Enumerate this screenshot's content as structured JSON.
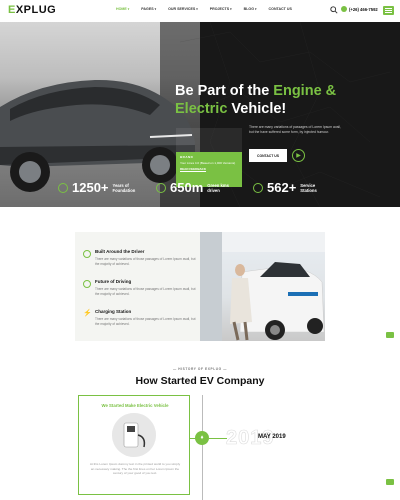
{
  "brand": {
    "logo_e": "E",
    "logo_rest": "XPLUG",
    "accent": "#7ac143"
  },
  "nav": {
    "items": [
      {
        "label": "HOME",
        "active": true
      },
      {
        "label": "PAGES"
      },
      {
        "label": "OUR SERVICES"
      },
      {
        "label": "PROJECTS"
      },
      {
        "label": "BLOG"
      },
      {
        "label": "CONTACT US"
      }
    ],
    "phone": "(+26) 466-7592"
  },
  "hero": {
    "title_1": "Be Part of the ",
    "title_engine": "Engine &",
    "title_electric": "Electric",
    "title_2": " Vehicle!",
    "promo_top": "BRAND",
    "promo_text": "Your Lines 4.0 (Based on 1,000 Versions)",
    "promo_link": "READ FEEDBACK",
    "desc": "There are many variations of passages of Lorem Ipsum avail, but the have suffered some form, by injected humour.",
    "cta": "CONTACT US"
  },
  "stats": [
    {
      "num": "1250+",
      "label": "Years of Foundation"
    },
    {
      "num": "650m",
      "label": "Green kms driven"
    },
    {
      "num": "562+",
      "label": "Service Stations"
    }
  ],
  "features": [
    {
      "title": "Built Around the Driver",
      "text": "There are many variations of those passages of Lorem Ipsum avail, but the majority of achieved."
    },
    {
      "title": "Future of Driving",
      "text": "There are many variations of those passages of Lorem Ipsum avail, but the majority of achieved."
    },
    {
      "title": "Charging Station",
      "text": "There are many variations of those passages of Lorem Ipsum avail, but the majority of achieved."
    }
  ],
  "history": {
    "kicker": "HISTORY OF EXPLUG",
    "title": "How Started EV Company",
    "card_title": "We Started Make Electric Vehicle",
    "card_text": "At this Lorem Ipsum dummy text in the printed world to you simply an necessary making. The the first lines on her Lorem Ipsum the century of your good of you text.",
    "year_ghost": "2019",
    "date": "MAY 2019"
  }
}
